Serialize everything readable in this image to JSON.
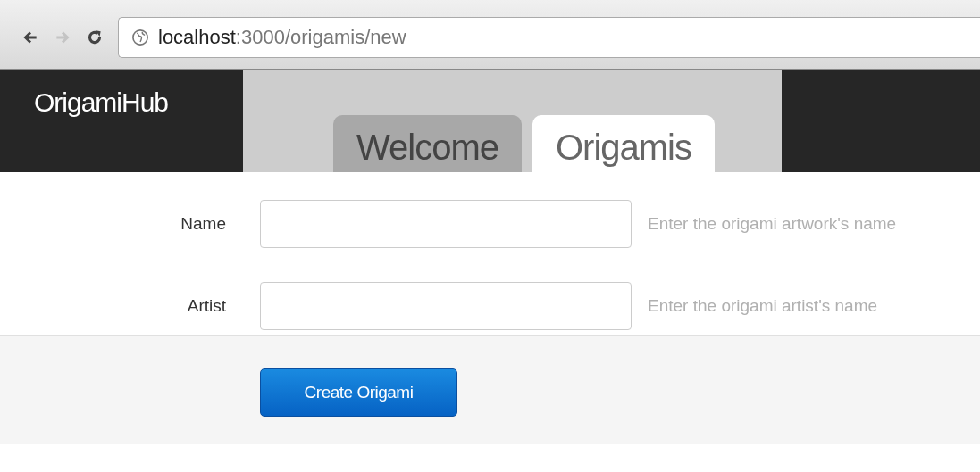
{
  "browser": {
    "nav_buttons": [
      {
        "kind": "back",
        "disabled": false
      },
      {
        "kind": "forward",
        "disabled": true
      },
      {
        "kind": "reload",
        "disabled": false
      }
    ],
    "url": {
      "host": "localhost",
      "rest": ":3000/origamis/new"
    }
  },
  "navbar": {
    "brand": "OrigamiHub",
    "tabs": [
      {
        "label": "Welcome",
        "selected": false
      },
      {
        "label": "Origamis",
        "selected": true
      }
    ]
  },
  "form": {
    "fields": [
      {
        "label": "Name",
        "help": "Enter the origami artwork's name"
      },
      {
        "label": "Artist",
        "help": "Enter the origami artist's name"
      }
    ],
    "submit": "Create Origami"
  }
}
